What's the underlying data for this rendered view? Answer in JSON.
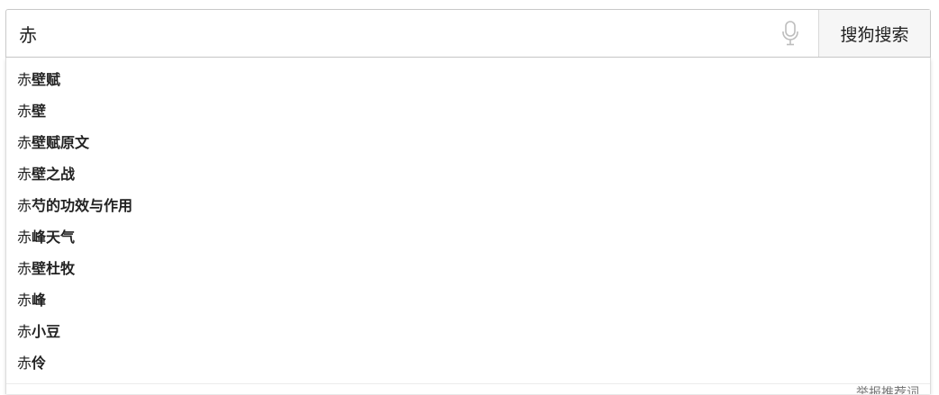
{
  "search": {
    "query": "赤",
    "button_label": "搜狗搜索",
    "mic_icon": "microphone-icon"
  },
  "suggestions": [
    {
      "prefix": "赤",
      "completion": "壁赋"
    },
    {
      "prefix": "赤",
      "completion": "壁"
    },
    {
      "prefix": "赤",
      "completion": "壁赋原文"
    },
    {
      "prefix": "赤",
      "completion": "壁之战"
    },
    {
      "prefix": "赤",
      "completion": "芍的功效与作用"
    },
    {
      "prefix": "赤",
      "completion": "峰天气"
    },
    {
      "prefix": "赤",
      "completion": "壁杜牧"
    },
    {
      "prefix": "赤",
      "completion": "峰"
    },
    {
      "prefix": "赤",
      "completion": "小豆"
    },
    {
      "prefix": "赤",
      "completion": "伶"
    }
  ],
  "footer": {
    "link_text": "举报推荐词"
  },
  "colors": {
    "border": "#c9c9c9",
    "button_bg": "#f6f6f6",
    "text": "#222222"
  }
}
